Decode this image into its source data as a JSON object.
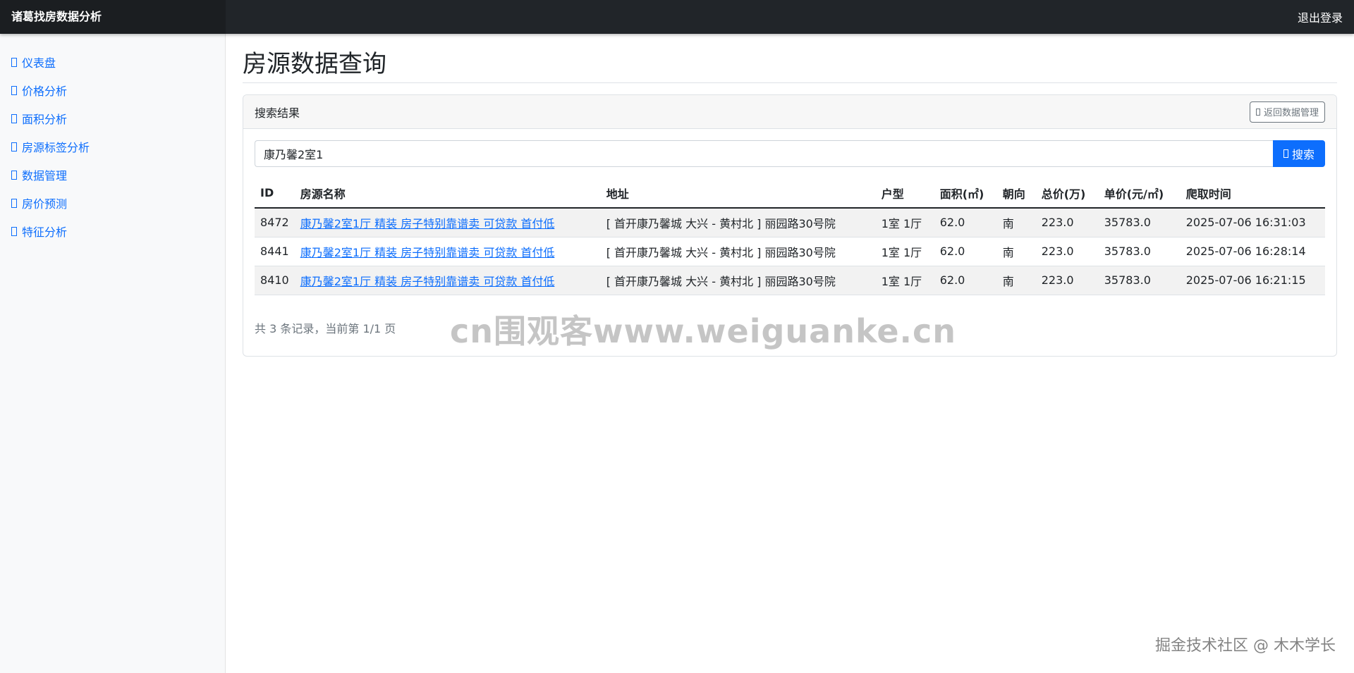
{
  "navbar": {
    "brand": "诸葛找房数据分析",
    "logout": "退出登录"
  },
  "sidebar": {
    "items": [
      {
        "label": "仪表盘"
      },
      {
        "label": "价格分析"
      },
      {
        "label": "面积分析"
      },
      {
        "label": "房源标签分析"
      },
      {
        "label": "数据管理"
      },
      {
        "label": "房价预测"
      },
      {
        "label": "特征分析"
      }
    ]
  },
  "page": {
    "title": "房源数据查询"
  },
  "card": {
    "title": "搜索结果",
    "back_label": "返回数据管理"
  },
  "search": {
    "value": "康乃馨2室1",
    "button_label": "搜索"
  },
  "table": {
    "headers": [
      "ID",
      "房源名称",
      "地址",
      "户型",
      "面积(㎡)",
      "朝向",
      "总价(万)",
      "单价(元/㎡)",
      "爬取时间"
    ],
    "rows": [
      [
        "8472",
        "康乃馨2室1厅 精装 房子特别靠谱卖 可贷款 首付低",
        "[ 首开康乃馨城 大兴 - 黄村北 ] 丽园路30号院",
        "1室 1厅",
        "62.0",
        "南",
        "223.0",
        "35783.0",
        "2025-07-06 16:31:03"
      ],
      [
        "8441",
        "康乃馨2室1厅 精装 房子特别靠谱卖 可贷款 首付低",
        "[ 首开康乃馨城 大兴 - 黄村北 ] 丽园路30号院",
        "1室 1厅",
        "62.0",
        "南",
        "223.0",
        "35783.0",
        "2025-07-06 16:28:14"
      ],
      [
        "8410",
        "康乃馨2室1厅 精装 房子特别靠谱卖 可贷款 首付低",
        "[ 首开康乃馨城 大兴 - 黄村北 ] 丽园路30号院",
        "1室 1厅",
        "62.0",
        "南",
        "223.0",
        "35783.0",
        "2025-07-06 16:21:15"
      ]
    ]
  },
  "pagination": {
    "info": "共 3 条记录，当前第 1/1 页"
  },
  "watermarks": {
    "center": "cn围观客www.weiguanke.cn",
    "corner": "掘金技术社区 @ 木木学长"
  }
}
